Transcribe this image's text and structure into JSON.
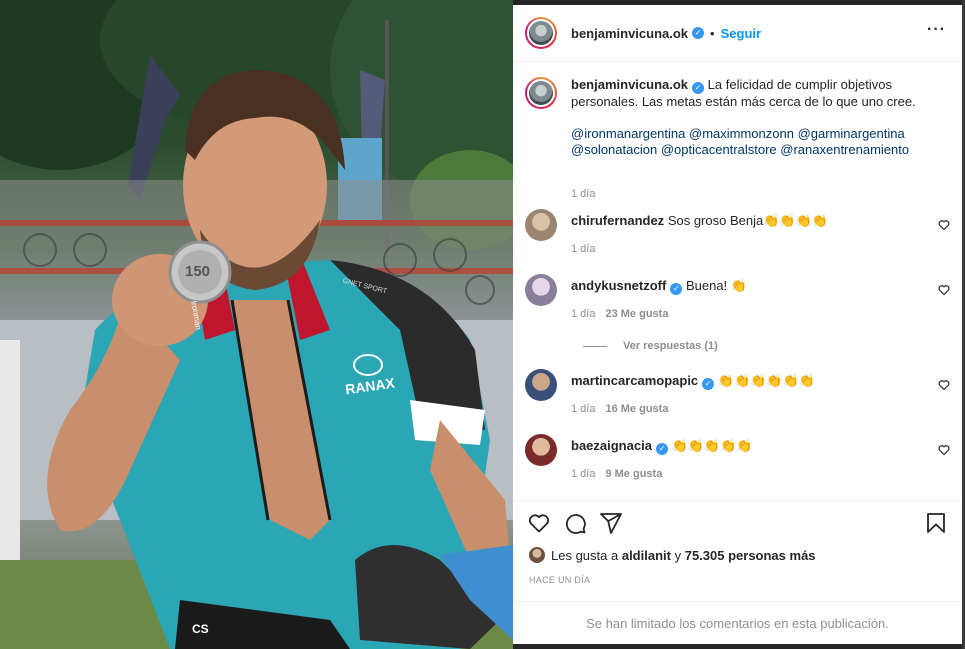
{
  "colors": {
    "accent": "#0095f6",
    "verified": "#3897f0",
    "muted": "#8e8e8e",
    "text": "#262626"
  },
  "post": {
    "author": "benjaminvicuna.ok",
    "follow_label": "Seguir",
    "separator": "•",
    "more_label": "···",
    "caption": "La felicidad de cumplir objetivos personales. Las metas están más cerca de lo que uno cree.",
    "mentions": [
      "@ironmanargentina",
      "@maximmonzonn",
      "@garminargentina",
      "@solonatacion",
      "@opticacentralstore",
      "@ranaxentrenamiento"
    ],
    "caption_time": "1 día"
  },
  "comments": [
    {
      "user": "chirufernandez",
      "verified": false,
      "text": "Sos groso Benja👏👏👏👏",
      "time": "1 día",
      "likes": ""
    },
    {
      "user": "andykusnetzoff",
      "verified": true,
      "text": "Buena! 👏",
      "time": "1 día",
      "likes": "23 Me gusta",
      "replies": "Ver respuestas (1)"
    },
    {
      "user": "martincarcamopapic",
      "verified": true,
      "text": "👏👏👏👏👏👏",
      "time": "1 día",
      "likes": "16 Me gusta"
    },
    {
      "user": "baezaignacia",
      "verified": true,
      "text": "👏👏👏👏👏",
      "time": "1 día",
      "likes": "9 Me gusta"
    }
  ],
  "actions": {
    "icons": [
      "heart-icon",
      "comment-icon",
      "share-icon",
      "bookmark-icon"
    ],
    "likes_prefix": "Les gusta a",
    "likes_user": "aldilanit",
    "likes_connector": "y",
    "likes_count": "75.305 personas más",
    "time_ago": "HACE UN DÍA",
    "comments_limited": "Se han limitado los comentarios en esta publicación."
  },
  "photo": {
    "jersey_brand": "RANAX",
    "medal_text": "150",
    "lanyard_text": "Ironman",
    "jersey_small_text": "GNET SPORT",
    "shorts_text": "CS"
  }
}
